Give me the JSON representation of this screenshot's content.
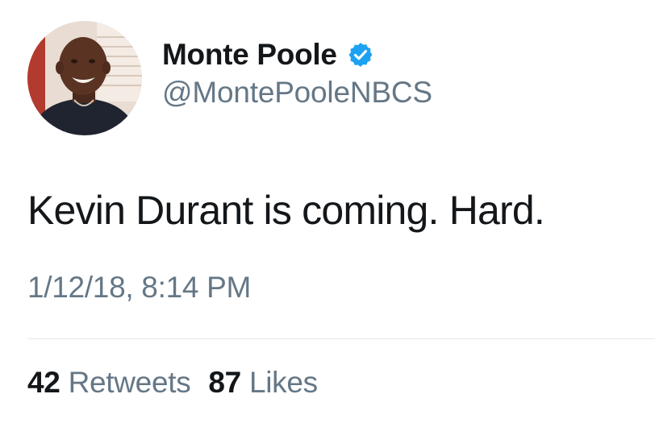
{
  "tweet": {
    "author": {
      "display_name": "Monte Poole",
      "handle": "@MontePooleNBCS",
      "verified": true,
      "verified_icon": "verified-badge-icon",
      "avatar": "profile-photo"
    },
    "text": "Kevin Durant is coming. Hard.",
    "timestamp": "1/12/18, 8:14 PM",
    "stats": {
      "retweets_count": "42",
      "retweets_label": "Retweets",
      "likes_count": "87",
      "likes_label": "Likes"
    }
  },
  "colors": {
    "text_primary": "#14171a",
    "text_secondary": "#657786",
    "verified_blue": "#1da1f2",
    "divider": "#e1e8ed"
  }
}
